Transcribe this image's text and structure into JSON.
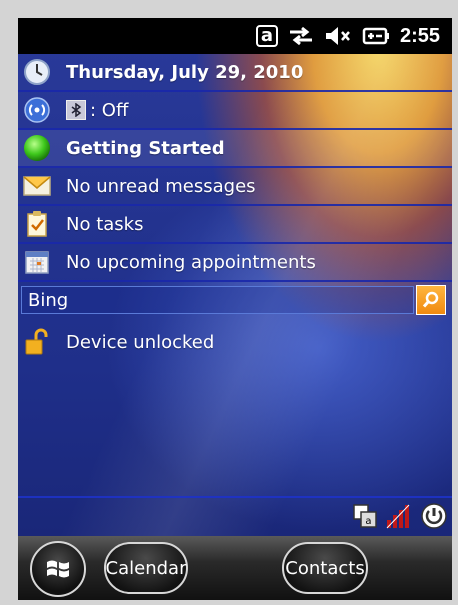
{
  "status_bar": {
    "keyboard_indicator": "a",
    "sync_icon": "sync-arrows-icon",
    "volume_icon": "speaker-muted-icon",
    "power_icon": "battery-charging-icon",
    "time": "2:55"
  },
  "today": {
    "items": [
      {
        "icon": "clock-icon",
        "text": "Thursday, July 29, 2010",
        "bold": true
      },
      {
        "icon": "wireless-icon",
        "text": ": Off",
        "sub_icon": "bluetooth-icon",
        "bold": false
      },
      {
        "icon": "getting-started-icon",
        "text": "Getting Started",
        "bold": true
      },
      {
        "icon": "envelope-icon",
        "text": "No unread messages",
        "bold": false
      },
      {
        "icon": "tasks-icon",
        "text": "No tasks",
        "bold": false
      },
      {
        "icon": "calendar-icon",
        "text": "No upcoming appointments",
        "bold": false
      }
    ],
    "search": {
      "value": "Bing",
      "button_icon": "search-icon"
    },
    "lock": {
      "icon": "padlock-open-icon",
      "text": "Device unlocked"
    }
  },
  "tray": {
    "icons": [
      "input-panel-icon",
      "signal-strength-icon",
      "power-tray-icon"
    ]
  },
  "softkeys": {
    "start_icon": "windows-flag-icon",
    "left_label": "Calendar",
    "right_label": "Contacts"
  },
  "colors": {
    "accent_orange": "#f5a020",
    "row_separator": "#1928aa",
    "status_bar": "#000000"
  }
}
